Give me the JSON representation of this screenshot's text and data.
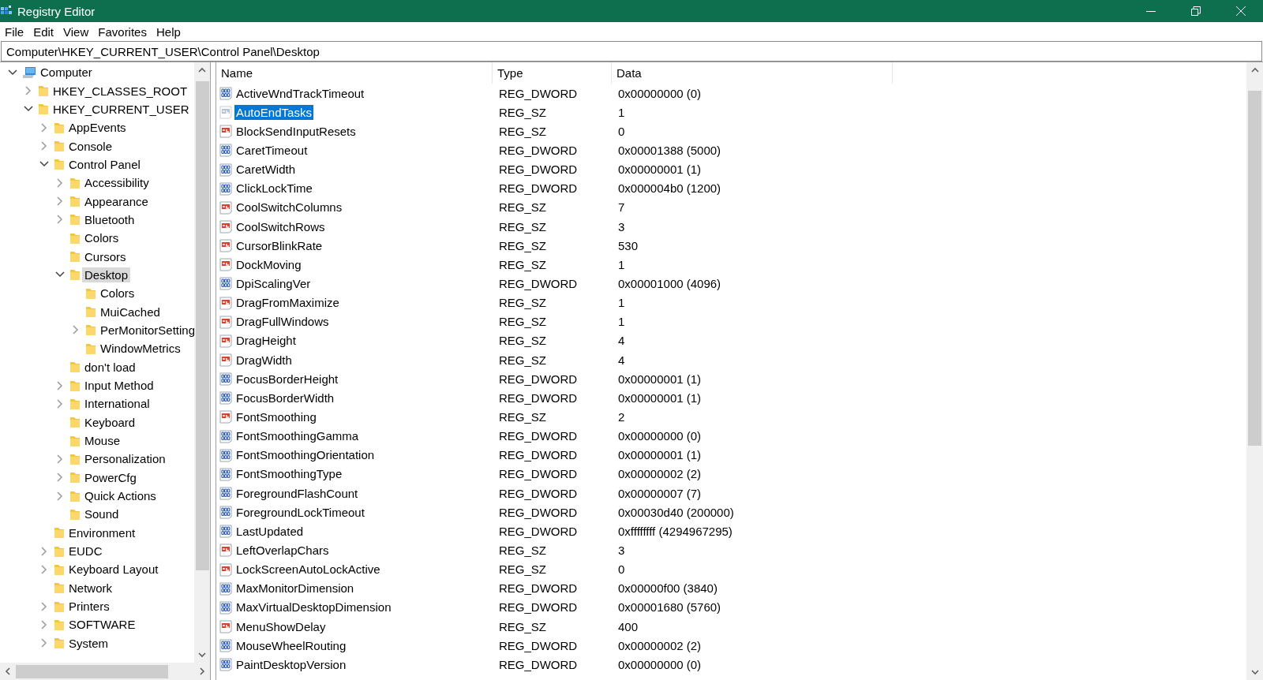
{
  "window": {
    "title": "Registry Editor"
  },
  "menu": [
    "File",
    "Edit",
    "View",
    "Favorites",
    "Help"
  ],
  "address": "Computer\\HKEY_CURRENT_USER\\Control Panel\\Desktop",
  "tree": [
    {
      "label": "Computer",
      "kind": "computer",
      "expandable": true,
      "expanded": true,
      "selected": false,
      "children": [
        {
          "label": "HKEY_CLASSES_ROOT",
          "kind": "folder",
          "expandable": true,
          "expanded": false,
          "selected": false
        },
        {
          "label": "HKEY_CURRENT_USER",
          "kind": "folder",
          "expandable": true,
          "expanded": true,
          "selected": false,
          "children": [
            {
              "label": "AppEvents",
              "kind": "folder",
              "expandable": true,
              "expanded": false,
              "selected": false
            },
            {
              "label": "Console",
              "kind": "folder",
              "expandable": true,
              "expanded": false,
              "selected": false
            },
            {
              "label": "Control Panel",
              "kind": "folder",
              "expandable": true,
              "expanded": true,
              "selected": false,
              "children": [
                {
                  "label": "Accessibility",
                  "kind": "folder",
                  "expandable": true,
                  "expanded": false,
                  "selected": false
                },
                {
                  "label": "Appearance",
                  "kind": "folder",
                  "expandable": true,
                  "expanded": false,
                  "selected": false
                },
                {
                  "label": "Bluetooth",
                  "kind": "folder",
                  "expandable": true,
                  "expanded": false,
                  "selected": false
                },
                {
                  "label": "Colors",
                  "kind": "folder",
                  "expandable": false,
                  "selected": false
                },
                {
                  "label": "Cursors",
                  "kind": "folder",
                  "expandable": false,
                  "selected": false
                },
                {
                  "label": "Desktop",
                  "kind": "folder",
                  "expandable": true,
                  "expanded": true,
                  "selected": true,
                  "children": [
                    {
                      "label": "Colors",
                      "kind": "folder",
                      "expandable": false,
                      "selected": false
                    },
                    {
                      "label": "MuiCached",
                      "kind": "folder",
                      "expandable": false,
                      "selected": false
                    },
                    {
                      "label": "PerMonitorSetting",
                      "kind": "folder",
                      "expandable": true,
                      "expanded": false,
                      "selected": false
                    },
                    {
                      "label": "WindowMetrics",
                      "kind": "folder",
                      "expandable": false,
                      "selected": false
                    }
                  ]
                },
                {
                  "label": "don't load",
                  "kind": "folder",
                  "expandable": false,
                  "selected": false
                },
                {
                  "label": "Input Method",
                  "kind": "folder",
                  "expandable": true,
                  "expanded": false,
                  "selected": false
                },
                {
                  "label": "International",
                  "kind": "folder",
                  "expandable": true,
                  "expanded": false,
                  "selected": false
                },
                {
                  "label": "Keyboard",
                  "kind": "folder",
                  "expandable": false,
                  "selected": false
                },
                {
                  "label": "Mouse",
                  "kind": "folder",
                  "expandable": false,
                  "selected": false
                },
                {
                  "label": "Personalization",
                  "kind": "folder",
                  "expandable": true,
                  "expanded": false,
                  "selected": false
                },
                {
                  "label": "PowerCfg",
                  "kind": "folder",
                  "expandable": true,
                  "expanded": false,
                  "selected": false
                },
                {
                  "label": "Quick Actions",
                  "kind": "folder",
                  "expandable": true,
                  "expanded": false,
                  "selected": false
                },
                {
                  "label": "Sound",
                  "kind": "folder",
                  "expandable": false,
                  "selected": false
                }
              ]
            },
            {
              "label": "Environment",
              "kind": "folder",
              "expandable": false,
              "selected": false
            },
            {
              "label": "EUDC",
              "kind": "folder",
              "expandable": true,
              "expanded": false,
              "selected": false
            },
            {
              "label": "Keyboard Layout",
              "kind": "folder",
              "expandable": true,
              "expanded": false,
              "selected": false
            },
            {
              "label": "Network",
              "kind": "folder",
              "expandable": false,
              "selected": false
            },
            {
              "label": "Printers",
              "kind": "folder",
              "expandable": true,
              "expanded": false,
              "selected": false
            },
            {
              "label": "SOFTWARE",
              "kind": "folder",
              "expandable": true,
              "expanded": false,
              "selected": false
            },
            {
              "label": "System",
              "kind": "folder",
              "expandable": true,
              "expanded": false,
              "selected": false
            }
          ]
        }
      ]
    }
  ],
  "table": {
    "columns": [
      "Name",
      "Type",
      "Data"
    ],
    "rows": [
      {
        "name": "ActiveWndTrackTimeout",
        "type": "REG_DWORD",
        "data": "0x00000000 (0)",
        "kind": "dword",
        "selected": false
      },
      {
        "name": "AutoEndTasks",
        "type": "REG_SZ",
        "data": "1",
        "kind": "sz",
        "selected": true
      },
      {
        "name": "BlockSendInputResets",
        "type": "REG_SZ",
        "data": "0",
        "kind": "sz",
        "selected": false
      },
      {
        "name": "CaretTimeout",
        "type": "REG_DWORD",
        "data": "0x00001388 (5000)",
        "kind": "dword",
        "selected": false
      },
      {
        "name": "CaretWidth",
        "type": "REG_DWORD",
        "data": "0x00000001 (1)",
        "kind": "dword",
        "selected": false
      },
      {
        "name": "ClickLockTime",
        "type": "REG_DWORD",
        "data": "0x000004b0 (1200)",
        "kind": "dword",
        "selected": false
      },
      {
        "name": "CoolSwitchColumns",
        "type": "REG_SZ",
        "data": "7",
        "kind": "sz",
        "selected": false
      },
      {
        "name": "CoolSwitchRows",
        "type": "REG_SZ",
        "data": "3",
        "kind": "sz",
        "selected": false
      },
      {
        "name": "CursorBlinkRate",
        "type": "REG_SZ",
        "data": "530",
        "kind": "sz",
        "selected": false
      },
      {
        "name": "DockMoving",
        "type": "REG_SZ",
        "data": "1",
        "kind": "sz",
        "selected": false
      },
      {
        "name": "DpiScalingVer",
        "type": "REG_DWORD",
        "data": "0x00001000 (4096)",
        "kind": "dword",
        "selected": false
      },
      {
        "name": "DragFromMaximize",
        "type": "REG_SZ",
        "data": "1",
        "kind": "sz",
        "selected": false
      },
      {
        "name": "DragFullWindows",
        "type": "REG_SZ",
        "data": "1",
        "kind": "sz",
        "selected": false
      },
      {
        "name": "DragHeight",
        "type": "REG_SZ",
        "data": "4",
        "kind": "sz",
        "selected": false
      },
      {
        "name": "DragWidth",
        "type": "REG_SZ",
        "data": "4",
        "kind": "sz",
        "selected": false
      },
      {
        "name": "FocusBorderHeight",
        "type": "REG_DWORD",
        "data": "0x00000001 (1)",
        "kind": "dword",
        "selected": false
      },
      {
        "name": "FocusBorderWidth",
        "type": "REG_DWORD",
        "data": "0x00000001 (1)",
        "kind": "dword",
        "selected": false
      },
      {
        "name": "FontSmoothing",
        "type": "REG_SZ",
        "data": "2",
        "kind": "sz",
        "selected": false
      },
      {
        "name": "FontSmoothingGamma",
        "type": "REG_DWORD",
        "data": "0x00000000 (0)",
        "kind": "dword",
        "selected": false
      },
      {
        "name": "FontSmoothingOrientation",
        "type": "REG_DWORD",
        "data": "0x00000001 (1)",
        "kind": "dword",
        "selected": false
      },
      {
        "name": "FontSmoothingType",
        "type": "REG_DWORD",
        "data": "0x00000002 (2)",
        "kind": "dword",
        "selected": false
      },
      {
        "name": "ForegroundFlashCount",
        "type": "REG_DWORD",
        "data": "0x00000007 (7)",
        "kind": "dword",
        "selected": false
      },
      {
        "name": "ForegroundLockTimeout",
        "type": "REG_DWORD",
        "data": "0x00030d40 (200000)",
        "kind": "dword",
        "selected": false
      },
      {
        "name": "LastUpdated",
        "type": "REG_DWORD",
        "data": "0xffffffff (4294967295)",
        "kind": "dword",
        "selected": false
      },
      {
        "name": "LeftOverlapChars",
        "type": "REG_SZ",
        "data": "3",
        "kind": "sz",
        "selected": false
      },
      {
        "name": "LockScreenAutoLockActive",
        "type": "REG_SZ",
        "data": "0",
        "kind": "sz",
        "selected": false
      },
      {
        "name": "MaxMonitorDimension",
        "type": "REG_DWORD",
        "data": "0x00000f00 (3840)",
        "kind": "dword",
        "selected": false
      },
      {
        "name": "MaxVirtualDesktopDimension",
        "type": "REG_DWORD",
        "data": "0x00001680 (5760)",
        "kind": "dword",
        "selected": false
      },
      {
        "name": "MenuShowDelay",
        "type": "REG_SZ",
        "data": "400",
        "kind": "sz",
        "selected": false
      },
      {
        "name": "MouseWheelRouting",
        "type": "REG_DWORD",
        "data": "0x00000002 (2)",
        "kind": "dword",
        "selected": false
      },
      {
        "name": "PaintDesktopVersion",
        "type": "REG_DWORD",
        "data": "0x00000000 (0)",
        "kind": "dword",
        "selected": false
      }
    ]
  }
}
